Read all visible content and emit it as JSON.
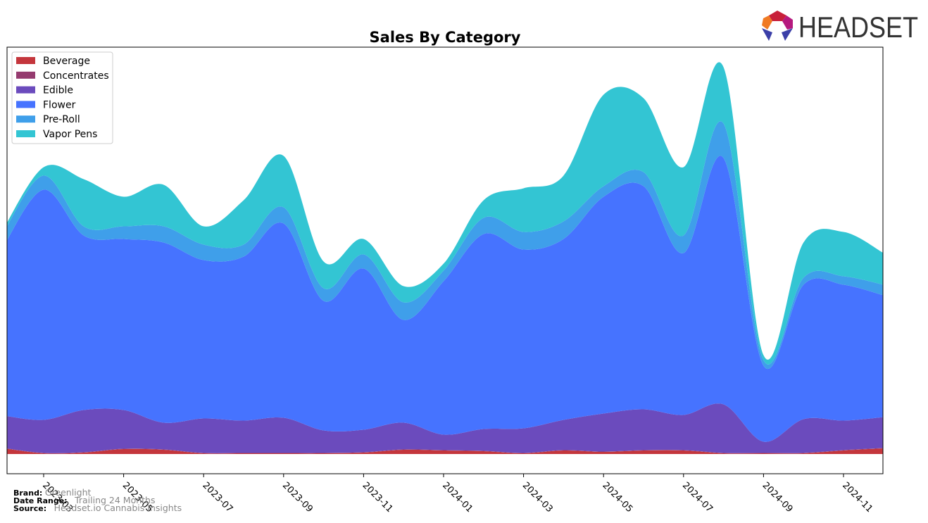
{
  "chart_data": {
    "type": "area",
    "title": "Sales By Category",
    "xlabel": "",
    "ylabel": "",
    "x": [
      "2023-02",
      "2023-03",
      "2023-04",
      "2023-05",
      "2023-06",
      "2023-07",
      "2023-08",
      "2023-09",
      "2023-10",
      "2023-11",
      "2023-12",
      "2024-01",
      "2024-02",
      "2024-03",
      "2024-04",
      "2024-05",
      "2024-06",
      "2024-07",
      "2024-08",
      "2024-09",
      "2024-10",
      "2024-11",
      "2024-12"
    ],
    "xticks": [
      "2023-03",
      "2023-05",
      "2023-07",
      "2023-09",
      "2023-11",
      "2024-01",
      "2024-03",
      "2024-05",
      "2024-07",
      "2024-09",
      "2024-11"
    ],
    "ylim": [
      -28,
      578
    ],
    "grid": false,
    "stacked": true,
    "legend_position": "top-left",
    "series": [
      {
        "name": "Beverage",
        "color": "#c4363c",
        "values": [
          8,
          1,
          2,
          7,
          6,
          1,
          1,
          1,
          1,
          2,
          6,
          5,
          4,
          1,
          5,
          3,
          5,
          5,
          1,
          1,
          1,
          5,
          8
        ]
      },
      {
        "name": "Concentrates",
        "color": "#953b6f",
        "values": [
          0.5,
          0.5,
          0.5,
          0.5,
          0.5,
          0.5,
          0.5,
          0.5,
          0.5,
          0.5,
          0.5,
          0.5,
          0.5,
          0.5,
          0.5,
          0.5,
          0.5,
          0.5,
          0.5,
          0.5,
          0.5,
          0.5,
          0.5
        ]
      },
      {
        "name": "Edible",
        "color": "#6b4bbd",
        "values": [
          46,
          47,
          60,
          55,
          38,
          49,
          46,
          50,
          32,
          32,
          38,
          22,
          31,
          35,
          43,
          54,
          58,
          50,
          69,
          16,
          48,
          42,
          44
        ]
      },
      {
        "name": "Flower",
        "color": "#4673ff",
        "values": [
          241,
          327,
          248,
          243,
          256,
          225,
          233,
          276,
          184,
          229,
          146,
          218,
          277,
          254,
          257,
          308,
          317,
          230,
          350,
          108,
          191,
          193,
          173
        ]
      },
      {
        "name": "Pre-Roll",
        "color": "#3f9fea",
        "values": [
          20,
          20,
          13,
          18,
          23,
          22,
          17,
          23,
          18,
          20,
          25,
          15,
          23,
          25,
          25,
          15,
          20,
          25,
          49,
          8,
          10,
          12,
          15
        ]
      },
      {
        "name": "Vapor Pens",
        "color": "#33c5d3",
        "values": [
          5,
          12,
          67,
          42,
          59,
          26,
          63,
          73,
          38,
          22,
          23,
          10,
          25,
          62,
          65,
          130,
          105,
          97,
          80,
          7,
          50,
          63,
          45
        ]
      }
    ]
  },
  "footer": {
    "brand_label": "Brand:",
    "brand": "Greenlight",
    "date_range_label": "Date Range:",
    "date_range": "Trailing 24 Months",
    "source_label": "Source:",
    "source": "Headset.io Cannabis Insights"
  },
  "logo": {
    "text": "HEADSET"
  }
}
